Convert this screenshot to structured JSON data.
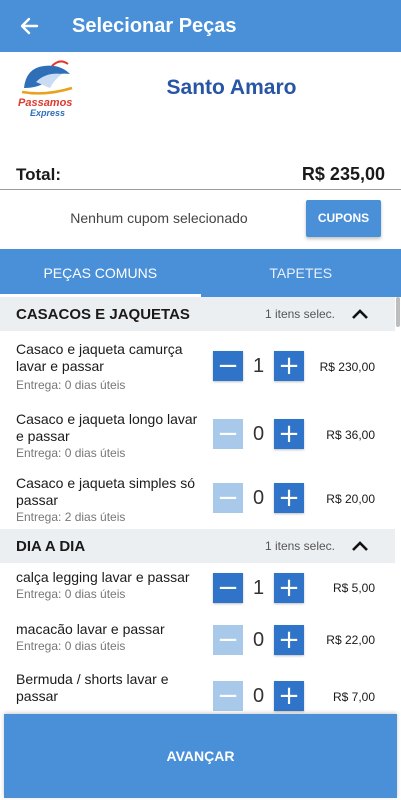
{
  "appbar": {
    "title": "Selecionar Peças",
    "back_icon": "arrow-left-icon"
  },
  "store": {
    "logo_line1": "Passamos",
    "logo_line2": "Express",
    "name": "Santo Amaro"
  },
  "total": {
    "label": "Total:",
    "value": "R$ 235,00"
  },
  "coupon": {
    "text": "Nenhum cupom selecionado",
    "button": "CUPONS"
  },
  "tabs": [
    {
      "label": "PEÇAS COMUNS",
      "active": true
    },
    {
      "label": "TAPETES",
      "active": false
    }
  ],
  "sections": [
    {
      "title": "CASACOS E JAQUETAS",
      "count": "1 itens selec.",
      "items": [
        {
          "name": "Casaco e jaqueta camurça lavar e passar",
          "eta": "Entrega: 0 dias úteis",
          "qty": "1",
          "price": "R$ 230,00"
        },
        {
          "name": "Casaco e jaqueta longo lavar e passar",
          "eta": "Entrega: 0 dias úteis",
          "qty": "0",
          "price": "R$ 36,00"
        },
        {
          "name": "Casaco e jaqueta simples só passar",
          "eta": "Entrega: 2 dias úteis",
          "qty": "0",
          "price": "R$ 20,00"
        }
      ]
    },
    {
      "title": "DIA A DIA",
      "count": "1 itens selec.",
      "items": [
        {
          "name": " calça legging lavar e passar",
          "eta": "Entrega: 0 dias úteis",
          "qty": "1",
          "price": "R$ 5,00"
        },
        {
          "name": " macacão lavar e passar",
          "eta": "Entrega: 0 dias úteis",
          "qty": "0",
          "price": "R$ 22,00"
        },
        {
          "name": "Bermuda / shorts lavar e passar",
          "eta": "",
          "qty": "0",
          "price": "R$ 7,00"
        }
      ]
    }
  ],
  "advance_button": "AVANÇAR",
  "colors": {
    "primary": "#4a90d9",
    "stepper": "#2f74c8",
    "stepper_disabled": "#a9c9ea",
    "store_name": "#2855a4"
  }
}
